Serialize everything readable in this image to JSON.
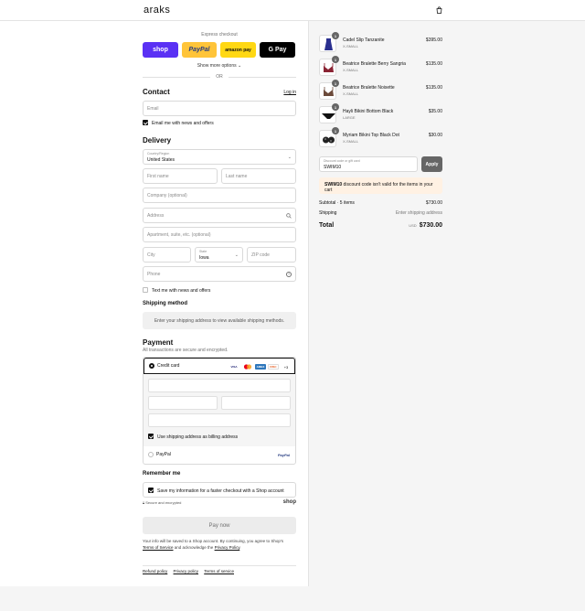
{
  "header": {
    "logo": "araks",
    "cart_icon": "shopping-bag-icon"
  },
  "express": {
    "title": "Express checkout",
    "buttons": [
      "shop",
      "PayPal",
      "amazon pay",
      "G Pay"
    ],
    "more": "Show more options",
    "or": "OR"
  },
  "contact": {
    "title": "Contact",
    "login": "Log in",
    "email_placeholder": "Email",
    "news_label": "Email me with news and offers"
  },
  "delivery": {
    "title": "Delivery",
    "country_label": "Country/Region",
    "country_value": "United States",
    "first_name": "First name",
    "last_name": "Last name",
    "company": "Company (optional)",
    "address": "Address",
    "apartment": "Apartment, suite, etc. (optional)",
    "city": "City",
    "state_label": "State",
    "state_value": "Iowa",
    "zip": "ZIP code",
    "phone": "Phone",
    "text_label": "Text me with news and offers"
  },
  "shipping": {
    "title": "Shipping method",
    "message": "Enter your shipping address to view available shipping methods."
  },
  "payment": {
    "title": "Payment",
    "subtitle": "All transactions are secure and encrypted.",
    "credit_card": "Credit card",
    "card_brands": [
      "VISA",
      "MC",
      "AMEX",
      "DISC"
    ],
    "more_brands": "+3",
    "billing_label": "Use shipping address as billing address",
    "paypal": "PayPal",
    "paypal_logo": "PayPal"
  },
  "remember": {
    "title": "Remember me",
    "save_label": "Save my information for a faster checkout with a Shop account",
    "secure": "Secure and encrypted",
    "shop": "shop"
  },
  "pay_now": "Pay now",
  "legal": {
    "text": "Your info will be saved to a Shop account. By continuing, you agree to Shop's",
    "tos": "Terms of Service",
    "and": "and acknowledge the",
    "privacy": "Privacy Policy",
    "period": "."
  },
  "footer": [
    "Refund policy",
    "Privacy policy",
    "Terms of service"
  ],
  "cart": {
    "items": [
      {
        "qty": "1",
        "name": "Cadel Slip Tanzanite",
        "variant": "X-SMALL",
        "price": "$395.00",
        "color": "#2a2f8f"
      },
      {
        "qty": "1",
        "name": "Beatrice Bralette Berry Sangria",
        "variant": "X-SMALL",
        "price": "$135.00",
        "color": "#8a2333"
      },
      {
        "qty": "1",
        "name": "Beatrice Bralette Noisette",
        "variant": "X-SMALL",
        "price": "$135.00",
        "color": "#6b4a3a"
      },
      {
        "qty": "1",
        "name": "Hayli Bikini Bottom Black",
        "variant": "LARGE",
        "price": "$35.00",
        "color": "#111111"
      },
      {
        "qty": "1",
        "name": "Myriam Bikini Top Black Dot",
        "variant": "X-SMALL",
        "price": "$30.00",
        "color": "#222222"
      }
    ],
    "discount_label": "Discount code or gift card",
    "discount_value": "SWIM10",
    "apply": "Apply",
    "warning_code": "SWIM10",
    "warning_text": " discount code isn't valid for the items in your cart",
    "subtotal_label": "Subtotal · 5 items",
    "subtotal_value": "$730.00",
    "shipping_label": "Shipping",
    "shipping_value": "Enter shipping address",
    "total_label": "Total",
    "currency": "USD",
    "total_value": "$730.00"
  }
}
